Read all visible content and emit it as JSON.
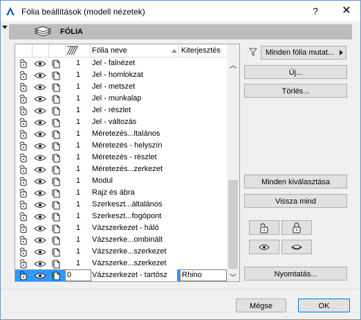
{
  "window": {
    "title": "Fólia beállítások (modell nézetek)",
    "help": "?",
    "close": "✕"
  },
  "section": {
    "title": "FÓLIA"
  },
  "table": {
    "columns": {
      "name": "Fólia neve",
      "extension": "Kiterjesztés"
    },
    "rows": [
      {
        "num": "1",
        "name": "Jel - falnézet"
      },
      {
        "num": "1",
        "name": "Jel - homlokzat"
      },
      {
        "num": "1",
        "name": "Jel - metszet"
      },
      {
        "num": "1",
        "name": "Jel - munkalap"
      },
      {
        "num": "1",
        "name": "Jel - részlet"
      },
      {
        "num": "1",
        "name": "Jel - változás"
      },
      {
        "num": "1",
        "name": "Méretezés...ltalános"
      },
      {
        "num": "1",
        "name": "Méretezés - helyszín"
      },
      {
        "num": "1",
        "name": "Méretezés - részlet"
      },
      {
        "num": "1",
        "name": "Méretezés...zerkezet"
      },
      {
        "num": "1",
        "name": "Modul"
      },
      {
        "num": "1",
        "name": "Rajz és ábra"
      },
      {
        "num": "1",
        "name": "Szerkeszt...általános"
      },
      {
        "num": "1",
        "name": "Szerkeszt...fogópont"
      },
      {
        "num": "1",
        "name": "Vázszerkezet - háló"
      },
      {
        "num": "1",
        "name": "Vázszerke...ombinált"
      },
      {
        "num": "1",
        "name": "Vázszerke...szerkezet"
      },
      {
        "num": "1",
        "name": "Vázszerke...szerkezet"
      }
    ],
    "selected": {
      "num": "0",
      "name": "Vázszerkezet - tartósz",
      "extension": "Rhino"
    }
  },
  "buttons": {
    "filter": "Minden fólia mutat...",
    "new": "Új...",
    "delete": "Törlés...",
    "select_all": "Minden kiválasztása",
    "revert_all": "Vissza mind",
    "print": "Nyomtatás...",
    "cancel": "Mégse",
    "ok": "OK"
  },
  "colors": {
    "selection": "#3399ff",
    "accent": "#0078d7"
  }
}
